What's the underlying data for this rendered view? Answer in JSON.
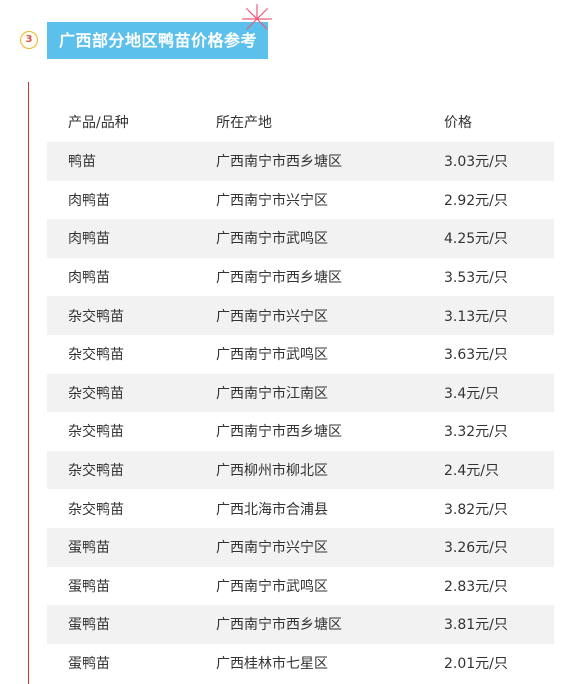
{
  "section": {
    "number": "3",
    "title": "广西部分地区鸭苗价格参考"
  },
  "table": {
    "headers": [
      "产品/品种",
      "所在产地",
      "价格"
    ],
    "rows": [
      [
        "鸭苗",
        "广西南宁市西乡塘区",
        "3.03元/只"
      ],
      [
        "肉鸭苗",
        "广西南宁市兴宁区",
        "2.92元/只"
      ],
      [
        "肉鸭苗",
        "广西南宁市武鸣区",
        "4.25元/只"
      ],
      [
        "肉鸭苗",
        "广西南宁市西乡塘区",
        "3.53元/只"
      ],
      [
        "杂交鸭苗",
        "广西南宁市兴宁区",
        "3.13元/只"
      ],
      [
        "杂交鸭苗",
        "广西南宁市武鸣区",
        "3.63元/只"
      ],
      [
        "杂交鸭苗",
        "广西南宁市江南区",
        "3.4元/只"
      ],
      [
        "杂交鸭苗",
        "广西南宁市西乡塘区",
        "3.32元/只"
      ],
      [
        "杂交鸭苗",
        "广西柳州市柳北区",
        "2.4元/只"
      ],
      [
        "杂交鸭苗",
        "广西北海市合浦县",
        "3.82元/只"
      ],
      [
        "蛋鸭苗",
        "广西南宁市兴宁区",
        "3.26元/只"
      ],
      [
        "蛋鸭苗",
        "广西南宁市武鸣区",
        "2.83元/只"
      ],
      [
        "蛋鸭苗",
        "广西南宁市西乡塘区",
        "3.81元/只"
      ],
      [
        "蛋鸭苗",
        "广西桂林市七星区",
        "2.01元/只"
      ]
    ]
  },
  "colors": {
    "title_bg": "#5bc0eb",
    "badge_border": "#f0b429",
    "accent_line": "#c0392b",
    "row_shade": "#f2f2f2"
  },
  "icons": {
    "decoration": "firework-icon"
  }
}
